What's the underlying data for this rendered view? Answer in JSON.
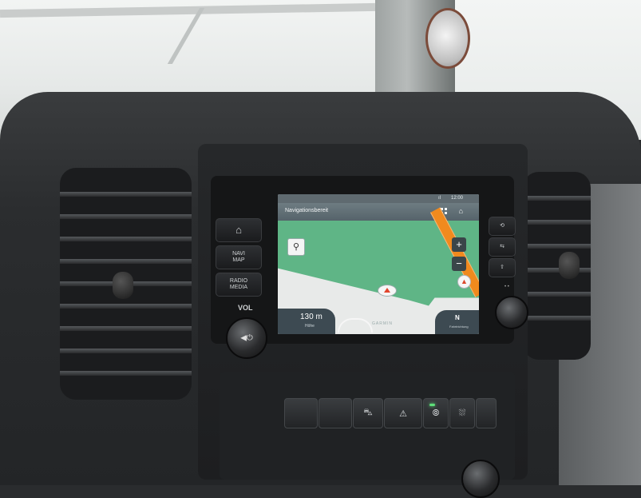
{
  "screen": {
    "status": {
      "time": "12:00",
      "signal": "ıl"
    },
    "title": "Navigationsbereit",
    "icons": {
      "apps": "grid-icon",
      "home": "home-icon"
    },
    "map": {
      "search_symbol": "⚲",
      "zoom_in": "+",
      "zoom_out": "−",
      "compass_symbol": "▲",
      "distance": "130 m",
      "distance_sub": "Höhe",
      "heading": "N",
      "heading_sub": "Fahrtrichtung",
      "brand": "GARMIN"
    }
  },
  "controls": {
    "home_symbol": "⌂",
    "navi_label": "NAVI\nMAP",
    "radio_label": "RADIO\nMEDIA",
    "vol_label": "VOL",
    "vol_symbol": "◀⏻",
    "right_buttons": [
      "⟲",
      "⇆",
      "⇧"
    ],
    "right_indicator": "• •"
  },
  "lower_buttons": [
    "",
    "",
    "⛍",
    "⚠",
    "⦾",
    "⛆",
    ""
  ],
  "colors": {
    "map_green": "#5fb586",
    "route": "#f08a1e",
    "header": "#55636a"
  }
}
